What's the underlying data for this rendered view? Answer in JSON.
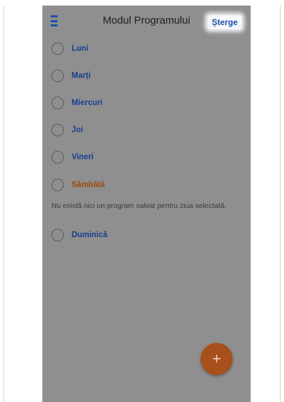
{
  "app": {
    "title": "Modul Programului",
    "delete_label": "Șterge"
  },
  "days": [
    {
      "label": "Luni",
      "selected": false
    },
    {
      "label": "Marți",
      "selected": false
    },
    {
      "label": "Miercuri",
      "selected": false
    },
    {
      "label": "Joi",
      "selected": false
    },
    {
      "label": "Vineri",
      "selected": false
    },
    {
      "label": "Sâmbătă",
      "selected": true
    },
    {
      "label": "Duminică",
      "selected": false
    }
  ],
  "empty_message": "Nu există nici un program salvat pentru ziua selectată.",
  "fab": {
    "symbol": "+",
    "icon": "plus-icon"
  },
  "colors": {
    "accent": "#1a4fa8",
    "active_day": "#9b4a10",
    "fab": "#a8501a",
    "overlay": "#8f8f8f"
  }
}
